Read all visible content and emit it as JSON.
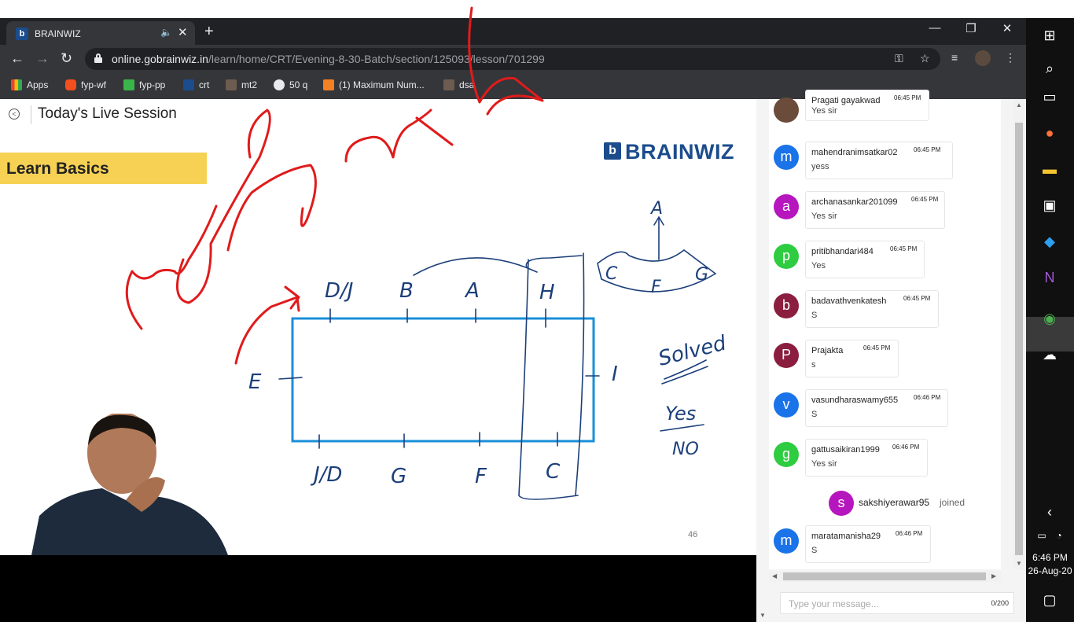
{
  "browser": {
    "tab_title": "BRAINWIZ",
    "url_host": "online.gobrainwiz.in",
    "url_path": "/learn/home/CRT/Evening-8-30-Batch/section/125093/lesson/701299",
    "bookmarks": [
      "Apps",
      "fyp-wf",
      "fyp-pp",
      "crt",
      "mt2",
      "50 q",
      "(1) Maximum Num...",
      "dsa"
    ]
  },
  "page": {
    "title": "Today's Live Session"
  },
  "slide": {
    "banner": "Learn Basics",
    "logo_text": "BRAINWIZ",
    "page_number": "46"
  },
  "chat": {
    "messages": [
      {
        "initial": "",
        "name": "Pragati gayakwad",
        "time": "06:45 PM",
        "text": "Yes sir",
        "color": "#6b4b3a"
      },
      {
        "initial": "m",
        "name": "mahendranimsatkar02",
        "time": "06:45 PM",
        "text": "yess",
        "color": "#1a73e8"
      },
      {
        "initial": "a",
        "name": "archanasankar201099",
        "time": "06:45 PM",
        "text": "Yes sir",
        "color": "#b616bd"
      },
      {
        "initial": "p",
        "name": "pritibhandari484",
        "time": "06:45 PM",
        "text": "Yes",
        "color": "#2ecc40"
      },
      {
        "initial": "b",
        "name": "badavathvenkatesh",
        "time": "06:45 PM",
        "text": "S",
        "color": "#8b1e3f"
      },
      {
        "initial": "P",
        "name": "Prajakta",
        "time": "06:45 PM",
        "text": "s",
        "color": "#8b1e3f"
      },
      {
        "initial": "v",
        "name": "vasundharaswamy655",
        "time": "06:46 PM",
        "text": "S",
        "color": "#1a73e8"
      },
      {
        "initial": "g",
        "name": "gattusaikiran1999",
        "time": "06:46 PM",
        "text": "Yes sir",
        "color": "#2ecc40"
      }
    ],
    "join": {
      "initial": "s",
      "name": "sakshiyerawar95",
      "word": "joined",
      "color": "#b616bd"
    },
    "last": {
      "initial": "m",
      "name": "maratamanisha29",
      "time": "06:46 PM",
      "text": "S",
      "color": "#1a73e8"
    },
    "input_placeholder": "Type your message...",
    "char_count": "0/200"
  },
  "taskbar": {
    "time": "6:46 PM",
    "date": "26-Aug-20"
  },
  "handwriting": {
    "diagram_labels": [
      "D/J",
      "B",
      "A",
      "H",
      "E",
      "I",
      "J/D",
      "G",
      "F",
      "C",
      "A",
      "C",
      "F",
      "G"
    ],
    "notes": [
      "Solved",
      "Yes",
      "NO"
    ]
  }
}
